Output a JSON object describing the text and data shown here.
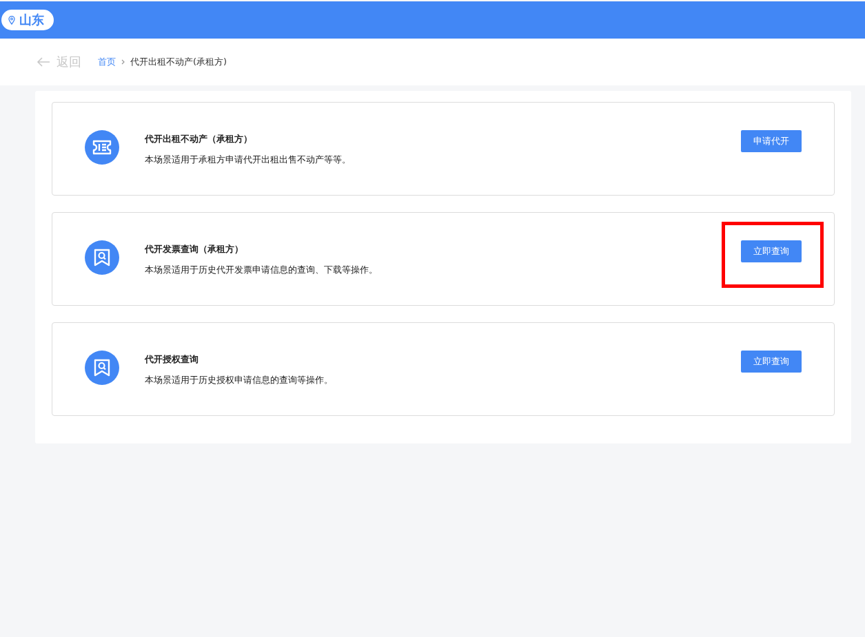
{
  "location": {
    "label": "山东"
  },
  "nav": {
    "back": "返回",
    "breadcrumb": [
      {
        "label": "首页",
        "link": true
      },
      {
        "label": "代开出租不动产(承租方)",
        "link": false
      }
    ]
  },
  "services": [
    {
      "kind": "ticket",
      "title": "代开出租不动产（承租方）",
      "description": "本场景适用于承租方申请代开出租出售不动产等等。",
      "button": "申请代开",
      "highlighted": false
    },
    {
      "kind": "query",
      "title": "代开发票查询（承租方）",
      "description": "本场景适用于历史代开发票申请信息的查询、下载等操作。",
      "button": "立即查询",
      "highlighted": true
    },
    {
      "kind": "query",
      "title": "代开授权查询",
      "description": "本场景适用于历史授权申请信息的查询等操作。",
      "button": "立即查询",
      "highlighted": false
    }
  ]
}
